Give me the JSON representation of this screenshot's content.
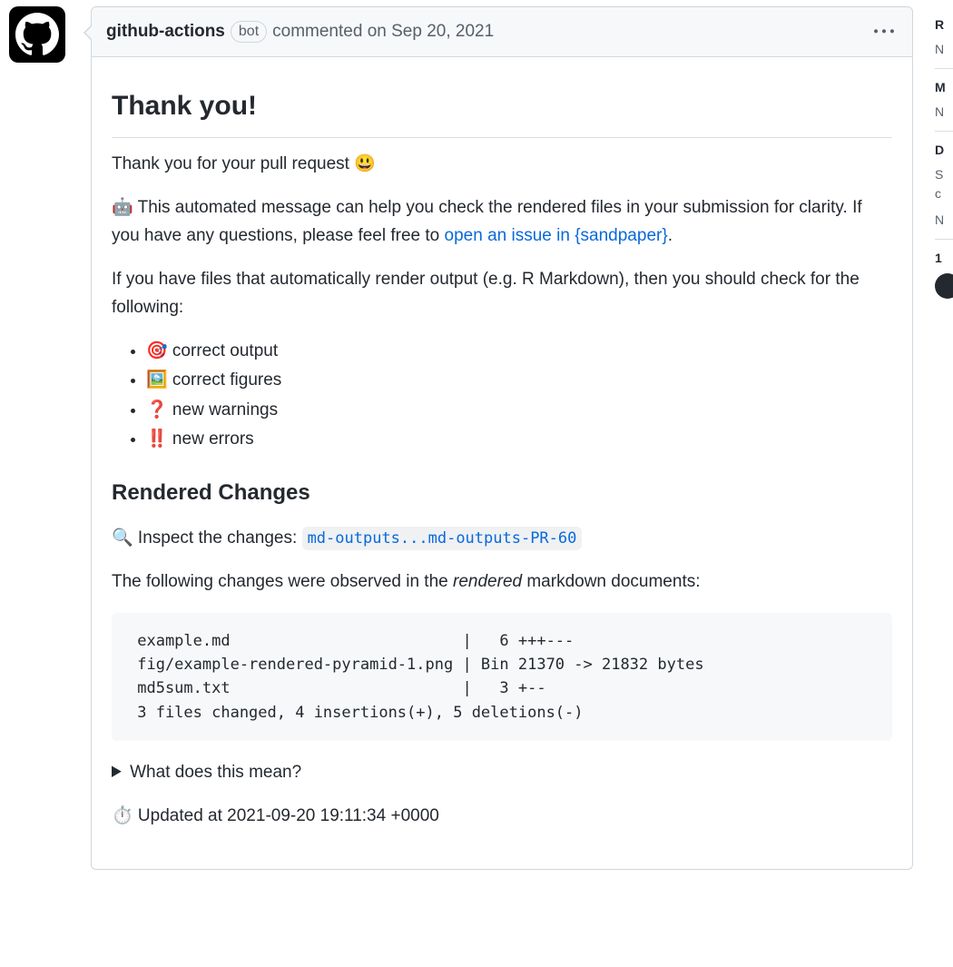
{
  "header": {
    "author": "github-actions",
    "bot_label": "bot",
    "action": "commented",
    "timestamp": "on Sep 20, 2021"
  },
  "body": {
    "title": "Thank you!",
    "intro": "Thank you for your pull request 😃",
    "auto_msg_pre": "🤖 This automated message can help you check the rendered files in your submission for clarity. If you have any questions, please feel free to ",
    "auto_msg_link": "open an issue in {sandpaper}",
    "auto_msg_post": ".",
    "render_note": "If you have files that automatically render output (e.g. R Markdown), then you should check for the following:",
    "checks": [
      "🎯 correct output",
      "🖼️ correct figures",
      "❓ new warnings",
      "‼️ new errors"
    ],
    "rendered_heading": "Rendered Changes",
    "inspect_pre": "🔍 Inspect the changes: ",
    "inspect_code": "md-outputs...md-outputs-PR-60",
    "observed_pre": "The following changes were observed in the ",
    "observed_em": "rendered",
    "observed_post": " markdown documents:",
    "diff": " example.md                         |   6 +++---\n fig/example-rendered-pyramid-1.png | Bin 21370 -> 21832 bytes\n md5sum.txt                         |   3 +--\n 3 files changed, 4 insertions(+), 5 deletions(-)",
    "details_summary": "What does this mean?",
    "updated": "⏱️ Updated at 2021-09-20 19:11:34 +0000"
  },
  "sidebar": {
    "s1_head": "R",
    "s1_val": "N",
    "s2_head": "M",
    "s2_val": "N",
    "s3_head": "D",
    "s3_val1": "S c",
    "s3_val2": "N",
    "s4_head": "1"
  }
}
